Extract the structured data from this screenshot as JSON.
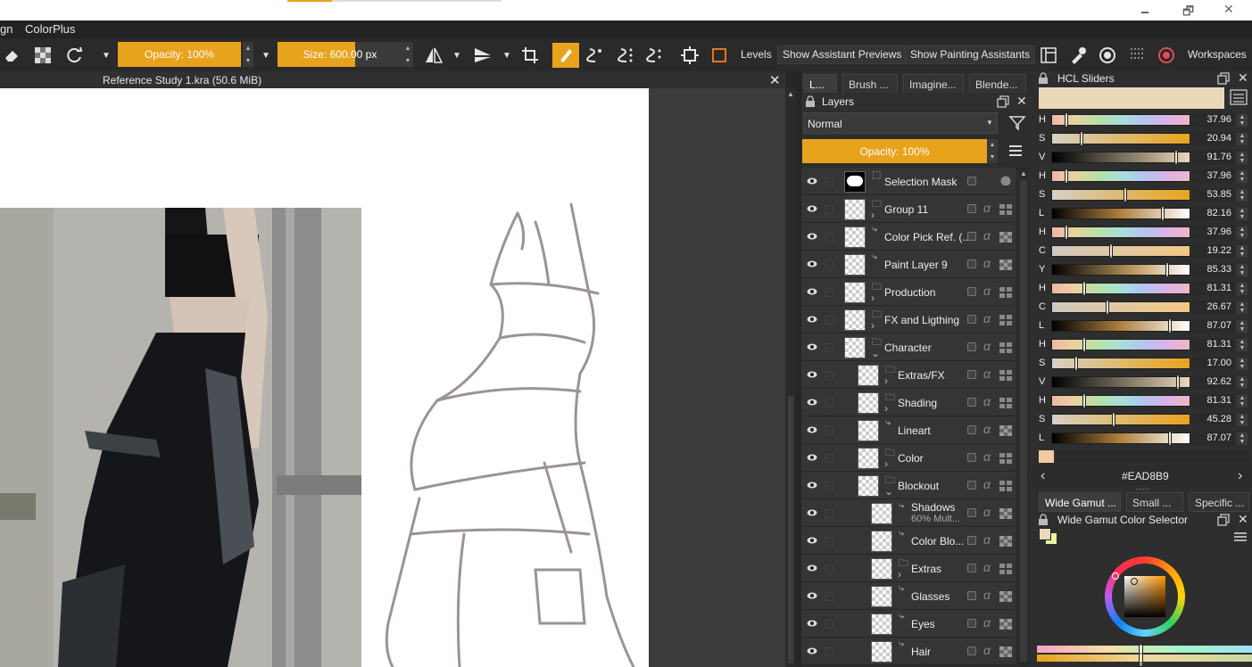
{
  "window": {
    "minimize": "🗕",
    "maximize": "🗗",
    "close": "✕"
  },
  "menubar": {
    "items": [
      "gn",
      "ColorPlus"
    ]
  },
  "toolbar": {
    "opacity": "Opacity: 100%",
    "size": "Size: 600.00 px",
    "levels": "Levels",
    "show_assistant_previews": "Show Assistant Previews",
    "show_painting_assistants": "Show Painting Assistants",
    "workspaces": "Workspaces"
  },
  "document": {
    "tab_title": "Reference Study 1.kra (50.6 MiB)"
  },
  "dock_tabs": [
    "L...",
    "Brush ...",
    "Imagine...",
    "Blende..."
  ],
  "layers_panel": {
    "title": "Layers",
    "blend_mode": "Normal",
    "opacity": "Opacity:  100%",
    "layers": [
      {
        "name": "Selection Mask",
        "type": "mask",
        "indent": 0
      },
      {
        "name": "Group 11",
        "type": "group",
        "indent": 0
      },
      {
        "name": "Color Pick Ref. (...",
        "type": "paint",
        "indent": 0
      },
      {
        "name": "Paint Layer 9",
        "type": "paint",
        "indent": 0
      },
      {
        "name": "Production",
        "type": "group",
        "indent": 0
      },
      {
        "name": "FX and Ligthing",
        "type": "group",
        "indent": 0
      },
      {
        "name": "Character",
        "type": "group",
        "indent": 0
      },
      {
        "name": "Extras/FX",
        "type": "group",
        "indent": 1
      },
      {
        "name": "Shading",
        "type": "group",
        "indent": 1
      },
      {
        "name": "Lineart",
        "type": "paint",
        "indent": 1
      },
      {
        "name": "Color",
        "type": "group",
        "indent": 1
      },
      {
        "name": "Blockout",
        "type": "group",
        "indent": 1
      },
      {
        "name": "Shadows",
        "sub": "60% Mult...",
        "type": "paint",
        "indent": 2
      },
      {
        "name": "Color Blo...",
        "type": "paint",
        "indent": 2
      },
      {
        "name": "Extras",
        "type": "group",
        "indent": 2
      },
      {
        "name": "Glasses",
        "type": "paint",
        "indent": 2
      },
      {
        "name": "Eyes",
        "type": "paint",
        "indent": 2
      },
      {
        "name": "Hair",
        "type": "paint",
        "indent": 2
      }
    ]
  },
  "hcl_panel": {
    "title": "HCL Sliders",
    "current_color": "#EAD8B9",
    "hex": "#EAD8B9",
    "sliders": [
      {
        "label": "H",
        "value": "37.96",
        "fraction": 0.1
      },
      {
        "label": "S",
        "value": "20.94",
        "fraction": 0.21
      },
      {
        "label": "V",
        "value": "91.76",
        "fraction": 0.92
      },
      {
        "label": "H",
        "value": "37.96",
        "fraction": 0.1
      },
      {
        "label": "S",
        "value": "53.85",
        "fraction": 0.54
      },
      {
        "label": "L",
        "value": "82.16",
        "fraction": 0.82
      },
      {
        "label": "H",
        "value": "37.96",
        "fraction": 0.1
      },
      {
        "label": "C",
        "value": "19.22",
        "fraction": 0.43
      },
      {
        "label": "Y",
        "value": "85.33",
        "fraction": 0.85
      },
      {
        "label": "H",
        "value": "81.31",
        "fraction": 0.23
      },
      {
        "label": "C",
        "value": "26.67",
        "fraction": 0.41
      },
      {
        "label": "L",
        "value": "87.07",
        "fraction": 0.87
      },
      {
        "label": "H",
        "value": "81.31",
        "fraction": 0.23
      },
      {
        "label": "S",
        "value": "17.00",
        "fraction": 0.17
      },
      {
        "label": "V",
        "value": "92.62",
        "fraction": 0.93
      },
      {
        "label": "H",
        "value": "81.31",
        "fraction": 0.23
      },
      {
        "label": "S",
        "value": "45.28",
        "fraction": 0.45
      },
      {
        "label": "L",
        "value": "87.07",
        "fraction": 0.87
      }
    ]
  },
  "selector_tabs": [
    "Wide Gamut ...",
    "Small ...",
    "Specific ..."
  ],
  "wide_gamut": {
    "title": "Wide Gamut Color Selector"
  },
  "colors": {
    "accent": "#E8A31D",
    "panel": "#2D2D2D",
    "canvas_bg": "#3B3B3B"
  }
}
